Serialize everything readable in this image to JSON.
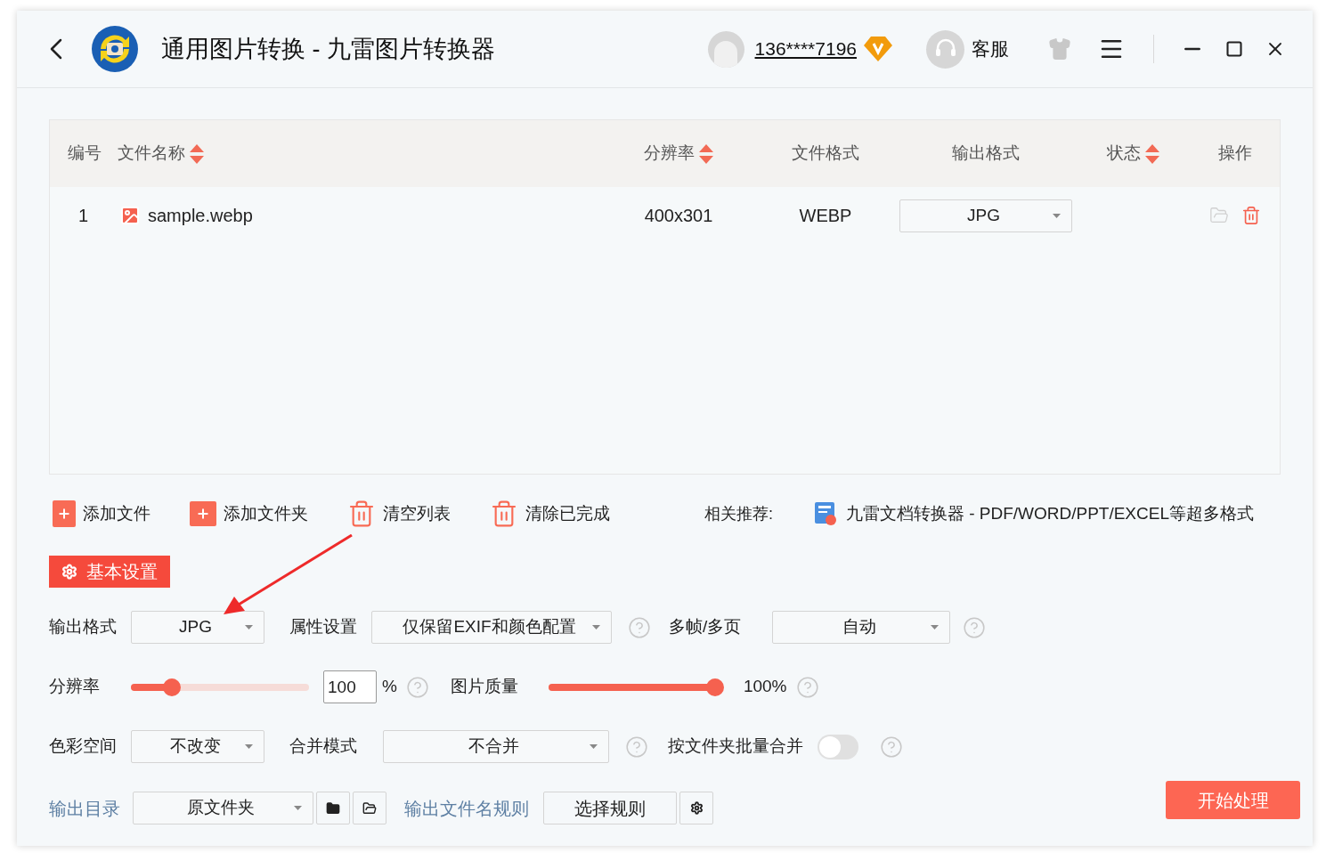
{
  "header": {
    "title": "通用图片转换 - 九雷图片转换器",
    "user": "136****7196",
    "support": "客服"
  },
  "table": {
    "columns": [
      {
        "label": "编号",
        "sortable": false
      },
      {
        "label": "文件名称",
        "sortable": true
      },
      {
        "label": "分辨率",
        "sortable": true
      },
      {
        "label": "文件格式",
        "sortable": false
      },
      {
        "label": "输出格式",
        "sortable": false
      },
      {
        "label": "状态",
        "sortable": true
      },
      {
        "label": "操作",
        "sortable": false
      }
    ],
    "rows": [
      {
        "index": "1",
        "name": "sample.webp",
        "resolution": "400x301",
        "format": "WEBP",
        "output": "JPG"
      }
    ]
  },
  "toolbar": {
    "actions": [
      {
        "label": "添加文件",
        "kind": "add-file"
      },
      {
        "label": "添加文件夹",
        "kind": "add-folder"
      },
      {
        "label": "清空列表",
        "kind": "clear"
      },
      {
        "label": "清除已完成",
        "kind": "clear-done"
      }
    ],
    "recommend_label": "相关推荐:",
    "recommend": "九雷文档转换器 - PDF/WORD/PPT/EXCEL等超多格式"
  },
  "settings_tab": "基本设置",
  "settings": {
    "output_format": {
      "label": "输出格式",
      "value": "JPG"
    },
    "attributes": {
      "label": "属性设置",
      "value": "仅保留EXIF和颜色配置"
    },
    "multiframe": {
      "label": "多帧/多页",
      "value": "自动"
    },
    "resolution": {
      "label": "分辨率",
      "level": 0.23,
      "value": "100",
      "unit": "%"
    },
    "quality": {
      "label": "图片质量",
      "level": 1,
      "reading": "100%"
    },
    "color_space": {
      "label": "色彩空间",
      "value": "不改变"
    },
    "merge_mode": {
      "label": "合并模式",
      "value": "不合并"
    },
    "batch_merge": {
      "label": "按文件夹批量合并",
      "on": false
    }
  },
  "footer": {
    "output_dir_label": "输出目录",
    "output_dir": "原文件夹",
    "rule_label": "输出文件名规则",
    "rule_button": "选择规则",
    "start": "开始处理"
  }
}
